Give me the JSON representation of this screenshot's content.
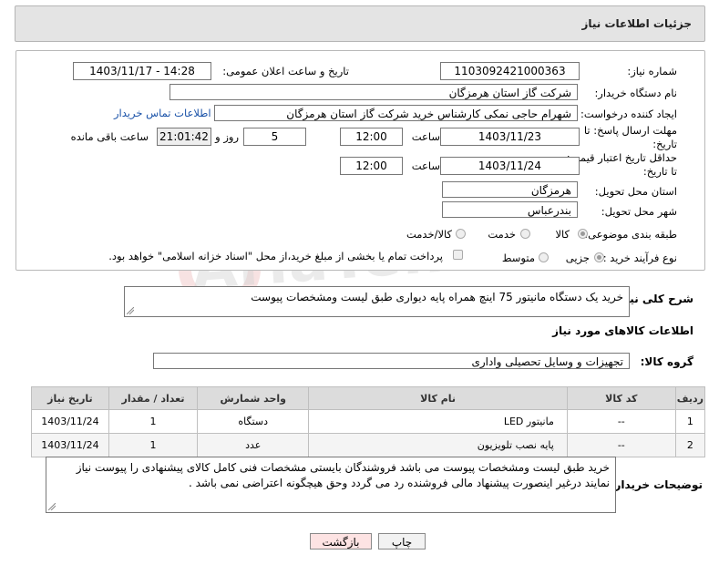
{
  "header": {
    "title": "جزئیات اطلاعات نیاز"
  },
  "form": {
    "need_number_label": "شماره نیاز:",
    "need_number": "1103092421000363",
    "announce_label": "تاریخ و ساعت اعلان عمومی:",
    "announce_value": "1403/11/17 - 14:28",
    "buyer_org_label": "نام دستگاه خریدار:",
    "buyer_org": "شرکت گاز استان هرمزگان",
    "requester_label": "ایجاد کننده درخواست:",
    "requester": "شهرام حاجی نمکی کارشناس خرید شرکت گاز استان هرمزگان",
    "buyer_contact_link": "اطلاعات تماس خریدار",
    "deadline_label": "مهلت ارسال پاسخ: تا تاریخ:",
    "deadline_date": "1403/11/23",
    "time_label": "ساعت",
    "deadline_time": "12:00",
    "days_value": "5",
    "days_label": "روز و",
    "remaining_time": "21:01:42",
    "remaining_label": "ساعت باقی مانده",
    "validity_label": "حداقل تاریخ اعتبار قیمت: تا تاریخ:",
    "validity_date": "1403/11/24",
    "validity_time": "12:00",
    "province_label": "استان محل تحویل:",
    "province": "هرمزگان",
    "city_label": "شهر محل تحویل:",
    "city": "بندرعباس",
    "category_label": "طبقه بندی موضوعی:",
    "category_options": [
      "کالا",
      "خدمت",
      "کالا/خدمت"
    ],
    "process_label": "نوع فرآیند خرید :",
    "process_options": [
      "جزیی",
      "متوسط"
    ],
    "payment_note": "پرداخت تمام یا بخشی از مبلغ خرید،از محل \"اسناد خزانه اسلامی\" خواهد بود."
  },
  "description": {
    "label": "شرح کلی نیاز:",
    "text": "خرید یک دستگاه مانیتور 75 اینچ همراه پایه دیواری طبق لیست ومشخصات پیوست"
  },
  "goods_section_title": "اطلاعات کالاهای مورد نیاز",
  "goods_group": {
    "label": "گروه کالا:",
    "value": "تجهیزات و وسایل تحصیلی واداری"
  },
  "items_table": {
    "headers": [
      "ردیف",
      "کد کالا",
      "نام کالا",
      "واحد شمارش",
      "تعداد / مقدار",
      "تاریخ نیاز"
    ],
    "rows": [
      [
        "1",
        "--",
        "مانیتور LED",
        "دستگاه",
        "1",
        "1403/11/24"
      ],
      [
        "2",
        "--",
        "پایه نصب تلویزیون",
        "عدد",
        "1",
        "1403/11/24"
      ]
    ]
  },
  "buyer_notes": {
    "label": "توضیحات خریدار:",
    "text": "خرید طبق لیست ومشخصات پیوست می باشد  فروشندگان بایستی مشخصات فنی کامل کالای پیشنهادی را پیوست نیاز نمایند درغیر اینصورت پیشنهاد مالی فروشنده رد می گردد وحق هیچگونه اعتراضی نمی باشد ."
  },
  "buttons": {
    "print": "چاپ",
    "back": "بازگشت"
  },
  "watermark": {
    "text": "AriaTender.net"
  },
  "colors": {
    "link": "#1a52a8",
    "back_button_bg": "#fde3e3",
    "print_button_bg": "#f2f2f2"
  }
}
